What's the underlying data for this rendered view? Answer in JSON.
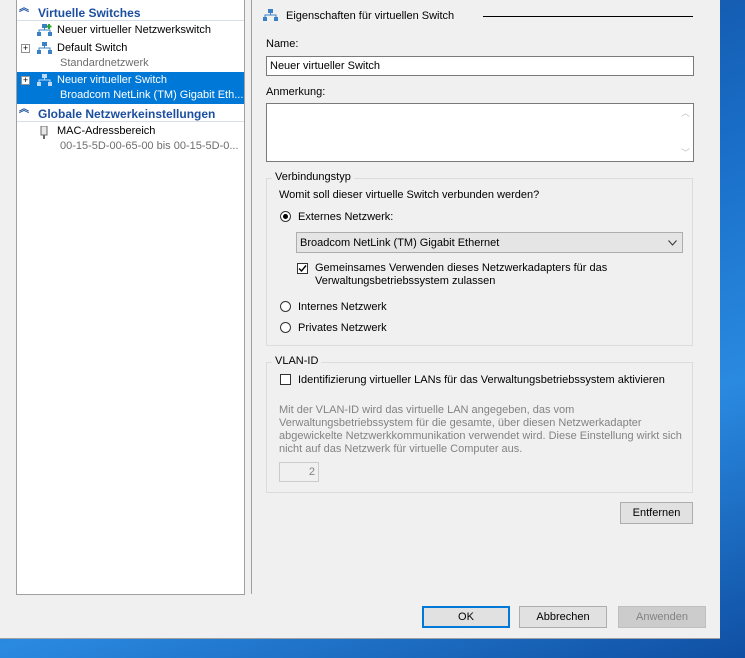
{
  "tree": {
    "section_switches": "Virtuelle Switches",
    "items": [
      {
        "label": "Neuer virtueller Netzwerkswitch"
      },
      {
        "label": "Default Switch",
        "sub": "Standardnetzwerk",
        "expander": "+"
      },
      {
        "label": "Neuer virtueller Switch",
        "sub": "Broadcom NetLink (TM) Gigabit Eth...",
        "expander": "+",
        "selected": true
      }
    ],
    "section_global": "Globale Netzwerkeinstellungen",
    "global_items": [
      {
        "label": "MAC-Adressbereich",
        "sub": "00-15-5D-00-65-00 bis 00-15-5D-0..."
      }
    ]
  },
  "properties": {
    "group_title": "Eigenschaften für virtuellen Switch",
    "name_label": "Name:",
    "name_value": "Neuer virtueller Switch",
    "notes_label": "Anmerkung:",
    "notes_value": ""
  },
  "connection": {
    "legend": "Verbindungstyp",
    "question": "Womit soll dieser virtuelle Switch verbunden werden?",
    "external_label": "Externes Netzwerk:",
    "external_selected": true,
    "adapter_value": "Broadcom NetLink (TM) Gigabit Ethernet",
    "share_line1": "Gemeinsames Verwenden dieses Netzwerkadapters für das",
    "share_line2": "Verwaltungsbetriebssystem zulassen",
    "share_checked": true,
    "internal_label": "Internes Netzwerk",
    "private_label": "Privates Netzwerk"
  },
  "vlan": {
    "legend": "VLAN-ID",
    "enable_label": "Identifizierung virtueller LANs für das Verwaltungsbetriebssystem aktivieren",
    "enable_checked": false,
    "desc1": "Mit der VLAN-ID wird das virtuelle LAN angegeben, das vom",
    "desc2": "Verwaltungsbetriebssystem für die gesamte, über diesen Netzwerkadapter",
    "desc3": "abgewickelte Netzwerkkommunikation verwendet wird. Diese Einstellung wirkt sich",
    "desc4": "nicht auf das Netzwerk für virtuelle Computer aus.",
    "id_value": "2"
  },
  "buttons": {
    "remove": "Entfernen",
    "ok": "OK",
    "cancel": "Abbrechen",
    "apply": "Anwenden"
  },
  "colors": {
    "accent": "#0078d7",
    "section_text": "#1c4fa0",
    "desktop": "#1565b8"
  }
}
